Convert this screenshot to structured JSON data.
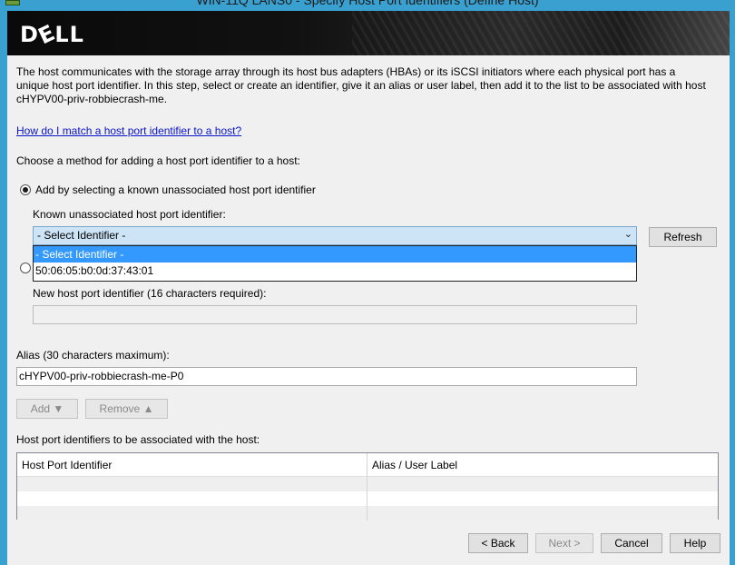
{
  "window": {
    "title": "WIN-11Q LANS0 - Specify Host Port Identifiers (Define Host)"
  },
  "banner": {
    "logo_text_pre": "D",
    "logo_text_e": "E",
    "logo_text_post": "LL"
  },
  "description": "The host communicates with the storage array through its host bus adapters (HBAs) or its iSCSI initiators where each physical port has a unique host port identifier. In this step, select or create an identifier, give it an alias or user label, then add it to the list to be associated with host cHYPV00-priv-robbiecrash-me.",
  "help_link": "How do I match a host port identifier to a host?",
  "method_prompt": "Choose a method for adding a host port identifier to a host:",
  "option_known": {
    "label": "Add by selecting a known unassociated host port identifier",
    "selected": true
  },
  "known_label": "Known unassociated host port identifier:",
  "known_select": {
    "value": "- Select Identifier -",
    "options": [
      "- Select Identifier -",
      "50:06:05:b0:0d:37:43:01"
    ]
  },
  "refresh_label": "Refresh",
  "option_new": {
    "selected": false
  },
  "new_label": "New host port identifier (16 characters required):",
  "new_value": "",
  "alias_label": "Alias (30 characters maximum):",
  "alias_value": "cHYPV00-priv-robbiecrash-me-P0",
  "add_label": "Add ▼",
  "remove_label": "Remove ▲",
  "associated_label": "Host port identifiers to be associated with the host:",
  "table": {
    "columns": [
      "Host Port Identifier",
      "Alias / User Label"
    ]
  },
  "footer": {
    "back": "< Back",
    "next": "Next >",
    "cancel": "Cancel",
    "help": "Help"
  }
}
